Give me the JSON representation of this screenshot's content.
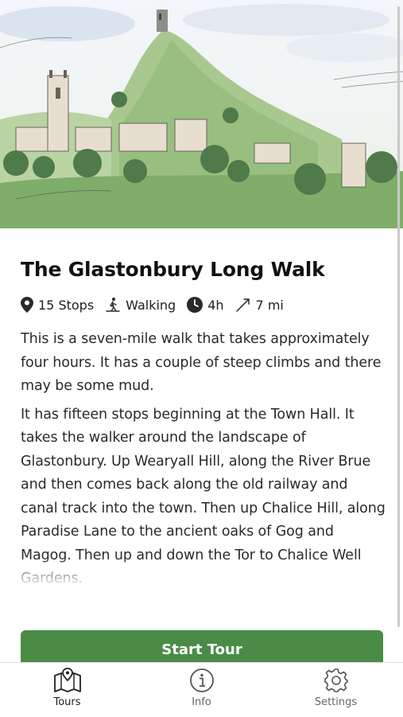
{
  "tour": {
    "title": "The Glastonbury Long Walk",
    "stops": "15 Stops",
    "mode": "Walking",
    "duration": "4h",
    "distance": "7 mi",
    "paragraph1": "This is a seven-mile walk that takes approximately four hours. It has a couple of steep climbs and there may be some mud.",
    "paragraph2": "It has fifteen stops beginning at the Town Hall. It takes the walker around the landscape of Glastonbury. Up Wearyall Hill, along the River Brue and then comes back along the old railway and canal track into the town. Then up Chalice Hill, along Paradise Lane to the ancient oaks of Gog and Magog. Then up and down the Tor to Chalice Well Gardens."
  },
  "start_button": {
    "label": "Start Tour",
    "color": "#4a8c46"
  },
  "tabs": [
    {
      "label": "Tours",
      "icon": "map-icon",
      "active": true
    },
    {
      "label": "Info",
      "icon": "info-icon",
      "active": false
    },
    {
      "label": "Settings",
      "icon": "gear-icon",
      "active": false
    }
  ],
  "icons": {
    "stops": "location-pin-icon",
    "mode": "walking-icon",
    "duration": "clock-icon",
    "distance": "route-icon"
  }
}
